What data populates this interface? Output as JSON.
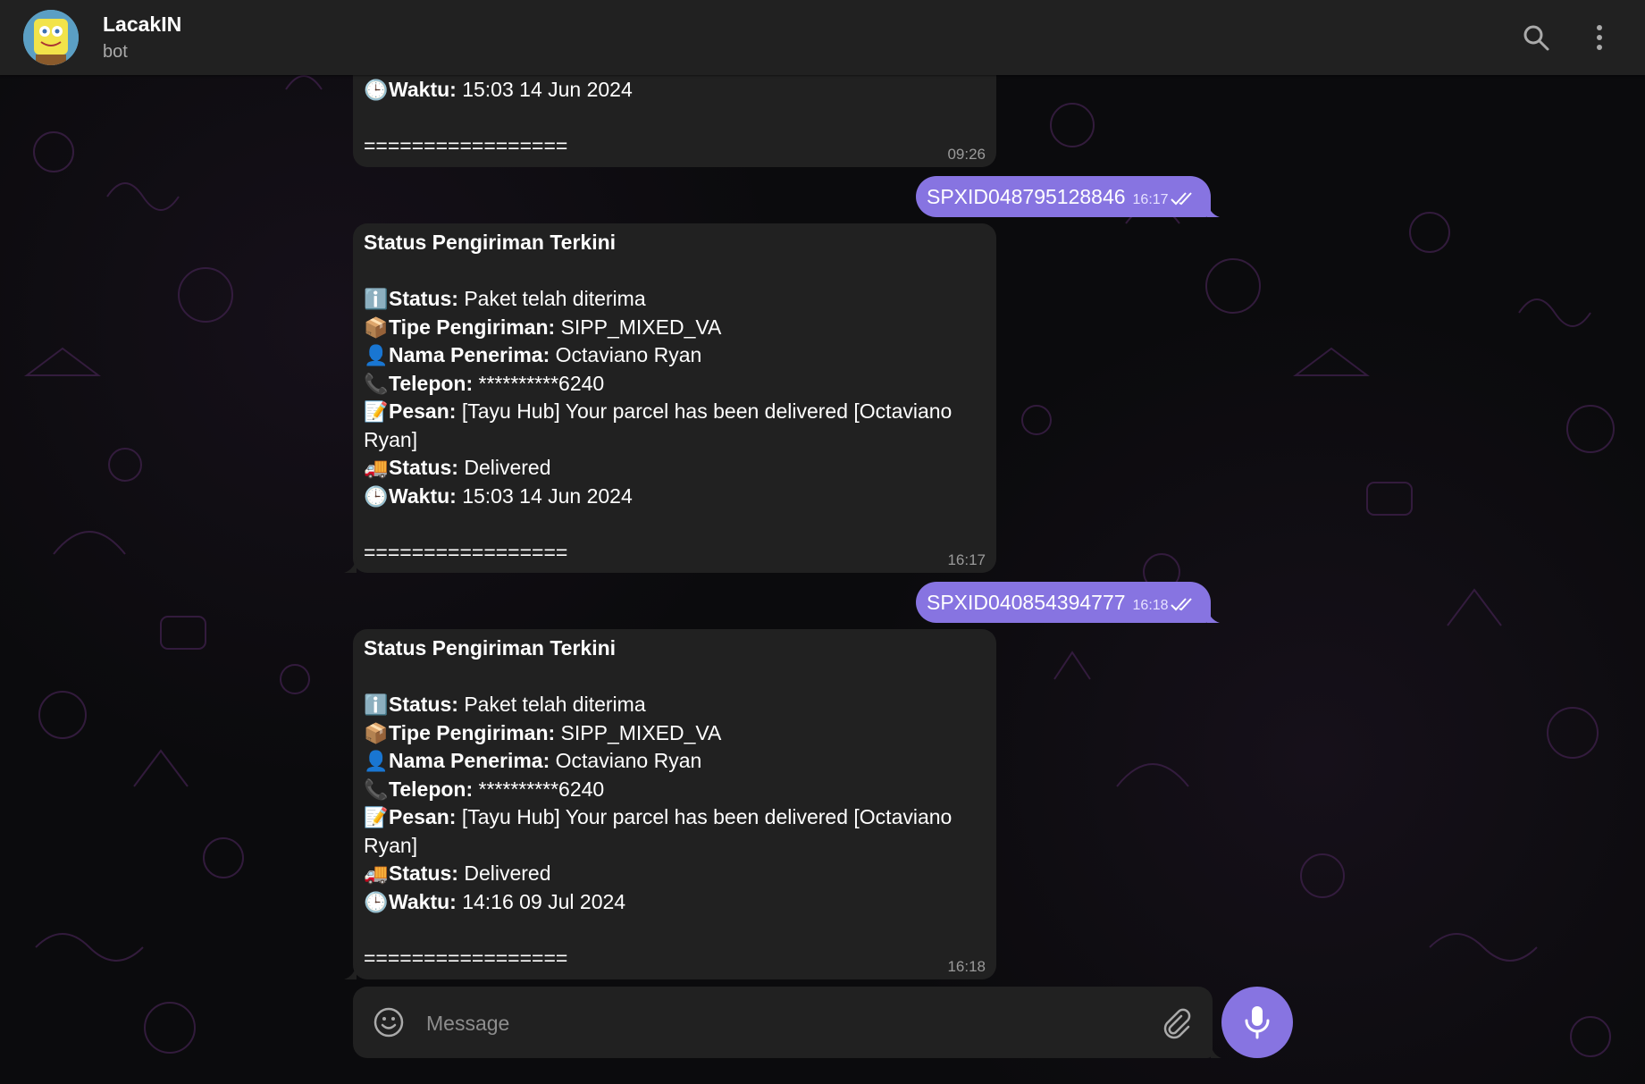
{
  "header": {
    "title": "LacakIN",
    "subtitle": "bot"
  },
  "composer": {
    "placeholder": "Message"
  },
  "colors": {
    "accent": "#8774e1",
    "header_bg": "#212121",
    "bubble_in_bg": "#212121"
  },
  "messages": {
    "m0": {
      "waktu_label": "Waktu:",
      "waktu_value": " 15:03 14 Jun 2024",
      "separator": "=================",
      "time": "09:26"
    },
    "out1": {
      "text": "SPXID048795128846",
      "time": "16:17"
    },
    "m1": {
      "title": "Status Pengiriman Terkini",
      "status_label": "Status:",
      "status_value": " Paket telah diterima",
      "tipe_label": "Tipe Pengiriman:",
      "tipe_value": " SIPP_MIXED_VA",
      "nama_label": "Nama Penerima:",
      "nama_value": " Octaviano Ryan",
      "telepon_label": "Telepon:",
      "telepon_value": " **********6240",
      "pesan_label": "Pesan:",
      "pesan_value": " [Tayu Hub] Your parcel has been delivered [Octaviano Ryan]",
      "status2_label": "Status:",
      "status2_value": " Delivered",
      "waktu_label": "Waktu:",
      "waktu_value": " 15:03 14 Jun 2024",
      "separator": "=================",
      "time": "16:17"
    },
    "out2": {
      "text": "SPXID040854394777",
      "time": "16:18"
    },
    "m2": {
      "title": "Status Pengiriman Terkini",
      "status_label": "Status:",
      "status_value": " Paket telah diterima",
      "tipe_label": "Tipe Pengiriman:",
      "tipe_value": " SIPP_MIXED_VA",
      "nama_label": "Nama Penerima:",
      "nama_value": " Octaviano Ryan",
      "telepon_label": "Telepon:",
      "telepon_value": " **********6240",
      "pesan_label": "Pesan:",
      "pesan_value": " [Tayu Hub] Your parcel has been delivered [Octaviano Ryan]",
      "status2_label": "Status:",
      "status2_value": " Delivered",
      "waktu_label": "Waktu:",
      "waktu_value": " 14:16 09 Jul 2024",
      "separator": "=================",
      "time": "16:18"
    }
  },
  "icons": {
    "info": "info-icon",
    "package": "package-icon",
    "person": "person-icon",
    "phone": "phone-icon",
    "memo": "memo-icon",
    "truck": "truck-icon",
    "clock": "clock-icon"
  }
}
